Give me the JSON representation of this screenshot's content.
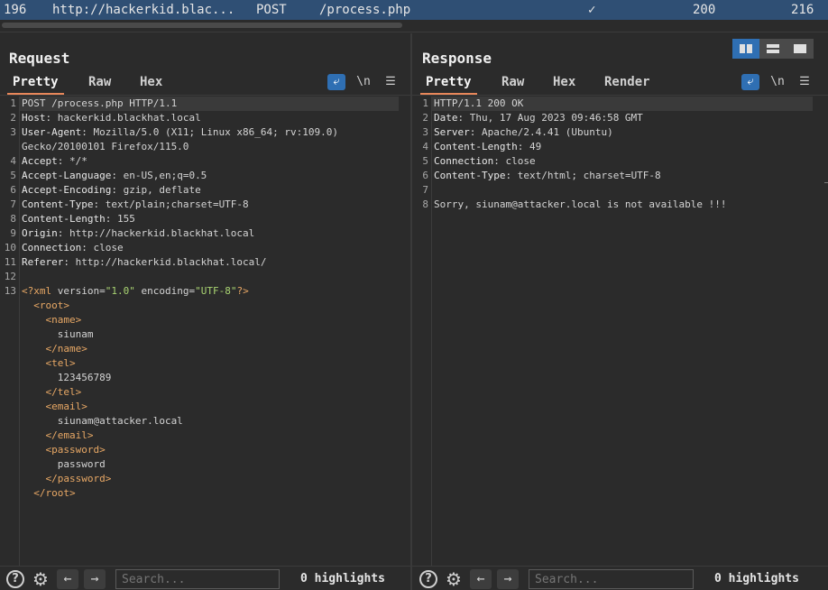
{
  "history_row": {
    "number": "196",
    "host": "http://hackerkid.blac...",
    "method": "POST",
    "url": "/process.php",
    "edited": "✓",
    "status": "200",
    "length": "216"
  },
  "request": {
    "title": "Request",
    "tabs": [
      "Pretty",
      "Raw",
      "Hex"
    ],
    "newline_toggle": "\\n",
    "lines": [
      {
        "n": "1",
        "text": "POST /process.php HTTP/1.1"
      },
      {
        "n": "2",
        "key": "Host",
        "val": "hackerkid.blackhat.local"
      },
      {
        "n": "3",
        "key": "User-Agent",
        "val": "Mozilla/5.0 (X11; Linux x86_64; rv:109.0)"
      },
      {
        "n": "",
        "text": "Gecko/20100101 Firefox/115.0"
      },
      {
        "n": "4",
        "key": "Accept",
        "val": "*/*"
      },
      {
        "n": "5",
        "key": "Accept-Language",
        "val": "en-US,en;q=0.5"
      },
      {
        "n": "6",
        "key": "Accept-Encoding",
        "val": "gzip, deflate"
      },
      {
        "n": "7",
        "key": "Content-Type",
        "val": "text/plain;charset=UTF-8"
      },
      {
        "n": "8",
        "key": "Content-Length",
        "val": "155"
      },
      {
        "n": "9",
        "key": "Origin",
        "val": "http://hackerkid.blackhat.local"
      },
      {
        "n": "10",
        "key": "Connection",
        "val": "close"
      },
      {
        "n": "11",
        "key": "Referer",
        "val": "http://hackerkid.blackhat.local/"
      },
      {
        "n": "12",
        "text": ""
      },
      {
        "n": "13",
        "text": "<?xml version=\"1.0\" encoding=\"UTF-8\"?>"
      },
      {
        "n": "",
        "text": "  <root>"
      },
      {
        "n": "",
        "text": "    <name>"
      },
      {
        "n": "",
        "text": "      siunam"
      },
      {
        "n": "",
        "text": "    </name>"
      },
      {
        "n": "",
        "text": "    <tel>"
      },
      {
        "n": "",
        "text": "      123456789"
      },
      {
        "n": "",
        "text": "    </tel>"
      },
      {
        "n": "",
        "text": "    <email>"
      },
      {
        "n": "",
        "text": "      siunam@attacker.local"
      },
      {
        "n": "",
        "text": "    </email>"
      },
      {
        "n": "",
        "text": "    <password>"
      },
      {
        "n": "",
        "text": "      password"
      },
      {
        "n": "",
        "text": "    </password>"
      },
      {
        "n": "",
        "text": "  </root>"
      }
    ],
    "search_placeholder": "Search...",
    "highlights": "0 highlights"
  },
  "response": {
    "title": "Response",
    "tabs": [
      "Pretty",
      "Raw",
      "Hex",
      "Render"
    ],
    "newline_toggle": "\\n",
    "lines": [
      {
        "n": "1",
        "text": "HTTP/1.1 200 OK"
      },
      {
        "n": "2",
        "key": "Date",
        "val": "Thu, 17 Aug 2023 09:46:58 GMT"
      },
      {
        "n": "3",
        "key": "Server",
        "val": "Apache/2.4.41 (Ubuntu)"
      },
      {
        "n": "4",
        "key": "Content-Length",
        "val": "49"
      },
      {
        "n": "5",
        "key": "Connection",
        "val": "close"
      },
      {
        "n": "6",
        "key": "Content-Type",
        "val": "text/html; charset=UTF-8"
      },
      {
        "n": "7",
        "text": ""
      },
      {
        "n": "8",
        "text": "Sorry, siunam@attacker.local is not available !!!"
      }
    ],
    "search_placeholder": "Search...",
    "highlights": "0 highlights"
  },
  "colors": {
    "accent": "#e8875a",
    "selection": "#2f4f74",
    "xml_tag": "#e8a865",
    "xml_string": "#a9d472"
  }
}
